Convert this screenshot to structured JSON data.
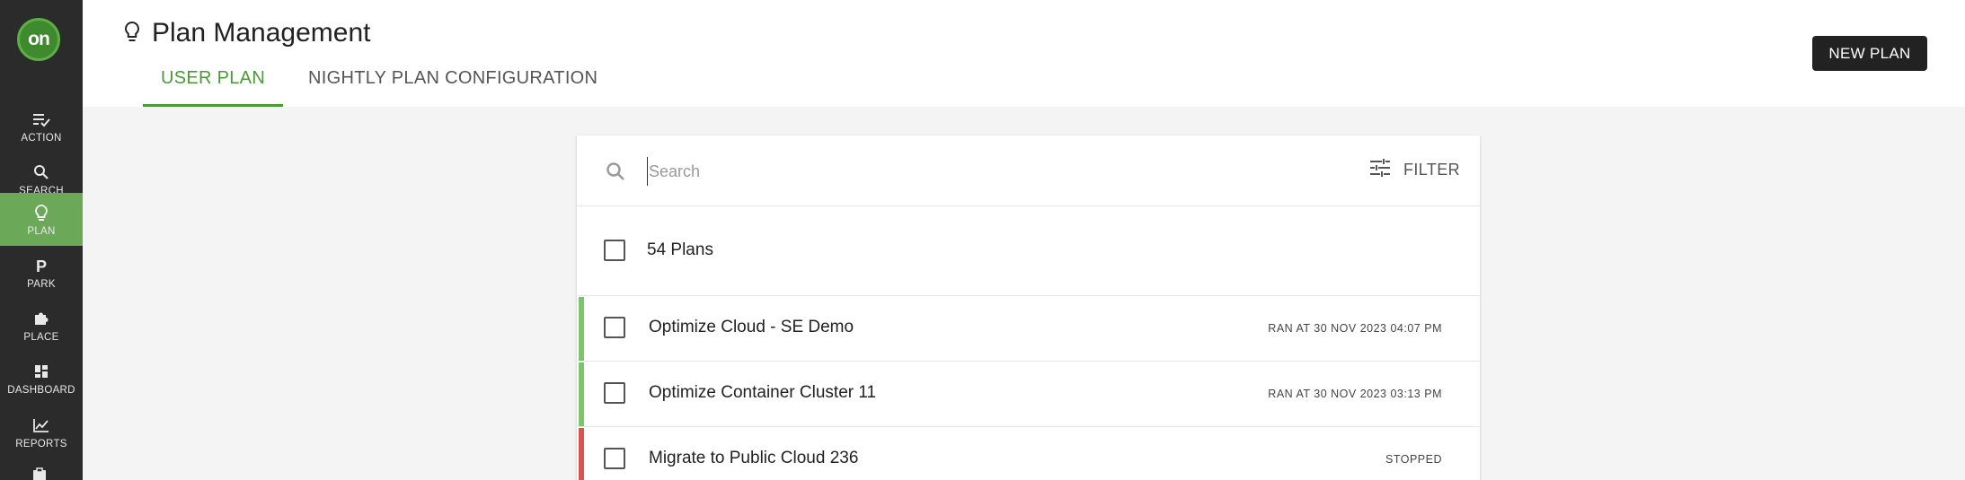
{
  "sidebar": {
    "logo_text": "on",
    "items": [
      {
        "label": "ACTION",
        "icon": "action-icon"
      },
      {
        "label": "SEARCH",
        "icon": "search-icon"
      },
      {
        "label": "PLAN",
        "icon": "lightbulb-icon",
        "active": true
      },
      {
        "label": "PARK",
        "icon": "park-icon"
      },
      {
        "label": "PLACE",
        "icon": "puzzle-icon"
      },
      {
        "label": "DASHBOARD",
        "icon": "dashboard-icon"
      },
      {
        "label": "REPORTS",
        "icon": "chart-icon"
      }
    ]
  },
  "header": {
    "title": "Plan Management",
    "title_icon": "lightbulb-icon",
    "tabs": [
      {
        "label": "USER PLAN",
        "active": true
      },
      {
        "label": "NIGHTLY PLAN CONFIGURATION",
        "active": false
      }
    ],
    "new_plan_label": "NEW PLAN"
  },
  "search": {
    "placeholder": "Search",
    "filter_label": "FILTER"
  },
  "plans": {
    "count_label": "54 Plans",
    "rows": [
      {
        "name": "Optimize Cloud - SE Demo",
        "status": "RAN AT 30 NOV 2023 04:07 PM",
        "status_color": "#7cc46a"
      },
      {
        "name": "Optimize Container Cluster 11",
        "status": "RAN AT 30 NOV 2023 03:13 PM",
        "status_color": "#7cc46a"
      },
      {
        "name": "Migrate to Public Cloud 236",
        "status": "STOPPED",
        "status_color": "#d9534f"
      }
    ]
  },
  "colors": {
    "accent": "#4a9a37",
    "sidebar_bg": "#2b2b2b",
    "active_nav": "#6ba857"
  }
}
